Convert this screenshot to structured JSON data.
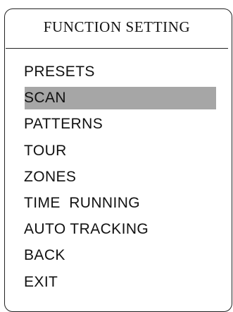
{
  "menu": {
    "title": "FUNCTION SETTING",
    "selected_index": 1,
    "items": [
      {
        "label": "PRESETS"
      },
      {
        "label": "SCAN"
      },
      {
        "label": "PATTERNS"
      },
      {
        "label": "TOUR"
      },
      {
        "label": "ZONES"
      },
      {
        "label": "TIME  RUNNING"
      },
      {
        "label": "AUTO TRACKING"
      },
      {
        "label": "BACK"
      },
      {
        "label": "EXIT"
      }
    ]
  },
  "colors": {
    "highlight": "#a6a6a6",
    "text": "#111111",
    "border": "#222222",
    "background": "#ffffff"
  }
}
